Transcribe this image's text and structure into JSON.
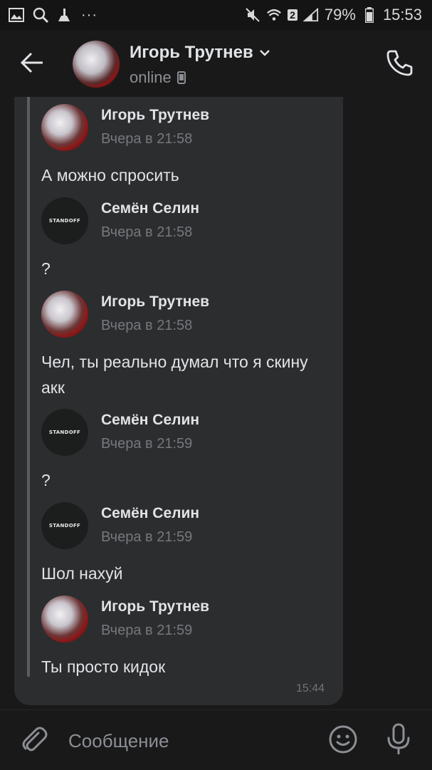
{
  "status_bar": {
    "battery": "79%",
    "time": "15:53",
    "sim_badge": "2",
    "more": "···"
  },
  "header": {
    "name": "Игорь Трутнев",
    "status": "online"
  },
  "forwarded": [
    {
      "author": "Игорь Трутнев",
      "time": "Вчера в 21:58",
      "text": "А можно спросить",
      "avatar": "igor"
    },
    {
      "author": "Семён Селин",
      "time": "Вчера в 21:58",
      "text": "?",
      "avatar": "semen"
    },
    {
      "author": "Игорь Трутнев",
      "time": "Вчера в 21:58",
      "text": "Чел, ты реально думал что я скину акк",
      "avatar": "igor"
    },
    {
      "author": "Семён Селин",
      "time": "Вчера в 21:59",
      "text": "?",
      "avatar": "semen"
    },
    {
      "author": "Семён Селин",
      "time": "Вчера в 21:59",
      "text": "Шол нахуй",
      "avatar": "semen"
    },
    {
      "author": "Игорь Трутнев",
      "time": "Вчера в 21:59",
      "text": "Ты просто кидок",
      "avatar": "igor"
    }
  ],
  "message_time": "15:44",
  "avatar_logo_text": "STANDOFF",
  "composer": {
    "placeholder": "Сообщение"
  },
  "colors": {
    "background": "#19191a",
    "bubble": "#2c2d2f",
    "text": "#e1e3e6",
    "secondary": "#76787d"
  }
}
